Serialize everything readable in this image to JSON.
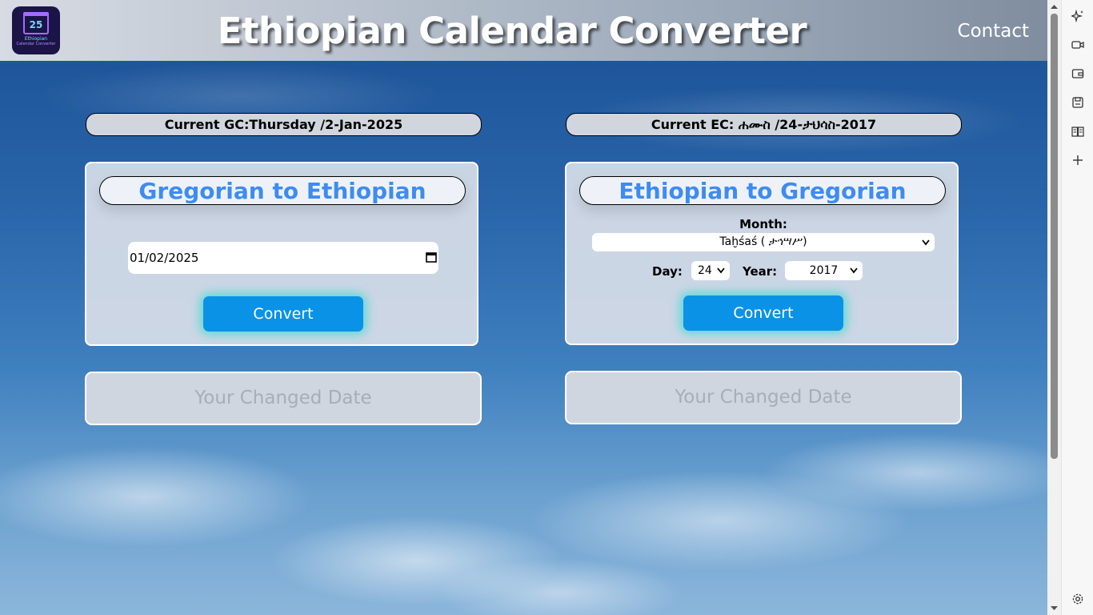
{
  "header": {
    "title": "Ethiopian Calendar Converter",
    "contact_label": "Contact",
    "logo": {
      "number": "25",
      "line1": "Ethiopian",
      "line2": "Calendar Converter"
    }
  },
  "current": {
    "gc": "Current GC:Thursday /2-Jan-2025",
    "ec": "Current EC: ሐሙስ /24-ታህሳስ-2017"
  },
  "gregorian_to_ethiopian": {
    "title": "Gregorian to Ethiopian",
    "date_value": "01/02/2025",
    "convert_label": "Convert",
    "result_placeholder": "Your Changed Date"
  },
  "ethiopian_to_gregorian": {
    "title": "Ethiopian to Gregorian",
    "month_label": "Month:",
    "month_value": "Taḫśaś ( ታኅሣሥ)",
    "day_label": "Day:",
    "day_value": "24",
    "year_label": "Year:",
    "year_value": "2017",
    "convert_label": "Convert",
    "result_placeholder": "Your Changed Date"
  },
  "colors": {
    "title_blue": "#3e8cef",
    "button_blue": "#0a92e6",
    "button_glow": "#00dcc8"
  },
  "side_panel": {
    "icons": [
      "copilot-sparkle-icon",
      "video-icon",
      "wallet-icon",
      "save-icon",
      "reader-icon",
      "add-icon",
      "settings-icon"
    ]
  }
}
